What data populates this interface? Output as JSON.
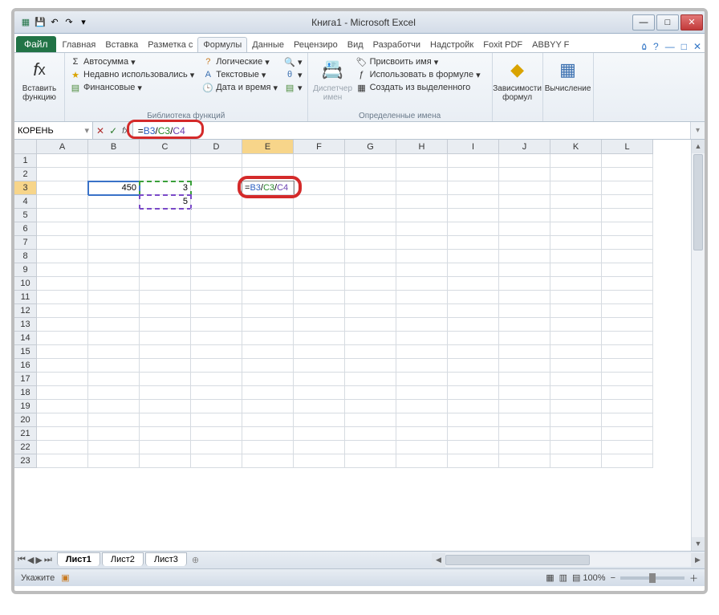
{
  "titlebar": {
    "title": "Книга1 - Microsoft Excel"
  },
  "tabs": {
    "file": "Файл",
    "items": [
      "Главная",
      "Вставка",
      "Разметка с",
      "Формулы",
      "Данные",
      "Рецензиро",
      "Вид",
      "Разработчи",
      "Надстройк",
      "Foxit PDF",
      "ABBYY F"
    ],
    "active_index": 3
  },
  "ribbon": {
    "insert_fn": "Вставить функцию",
    "lib": {
      "autosum": "Автосумма",
      "recent": "Недавно использовались",
      "financial": "Финансовые",
      "logical": "Логические",
      "text": "Текстовые",
      "datetime": "Дата и время",
      "label": "Библиотека функций"
    },
    "names": {
      "manager": "Диспетчер имен",
      "define": "Присвоить имя",
      "use": "Использовать в формуле",
      "create": "Создать из выделенного",
      "label": "Определенные имена"
    },
    "deps": "Зависимости формул",
    "calc": "Вычисление"
  },
  "formula_bar": {
    "name_box": "КОРЕНЬ",
    "formula": "=B3/C3/C4",
    "parts": {
      "eq": "=",
      "r1": "B3",
      "op": "/",
      "r2": "C3",
      "r3": "C4"
    }
  },
  "columns": [
    "A",
    "B",
    "C",
    "D",
    "E",
    "F",
    "G",
    "H",
    "I",
    "J",
    "K",
    "L"
  ],
  "cells": {
    "B3": "450",
    "C3": "3",
    "C4": "5",
    "E3_formula": "=B3/C3/C4"
  },
  "sheets": {
    "nav": [
      "⏮",
      "◀",
      "▶",
      "⏭"
    ],
    "tabs": [
      "Лист1",
      "Лист2",
      "Лист3"
    ],
    "active": 0
  },
  "status": {
    "mode": "Укажите",
    "zoom": "100%"
  }
}
